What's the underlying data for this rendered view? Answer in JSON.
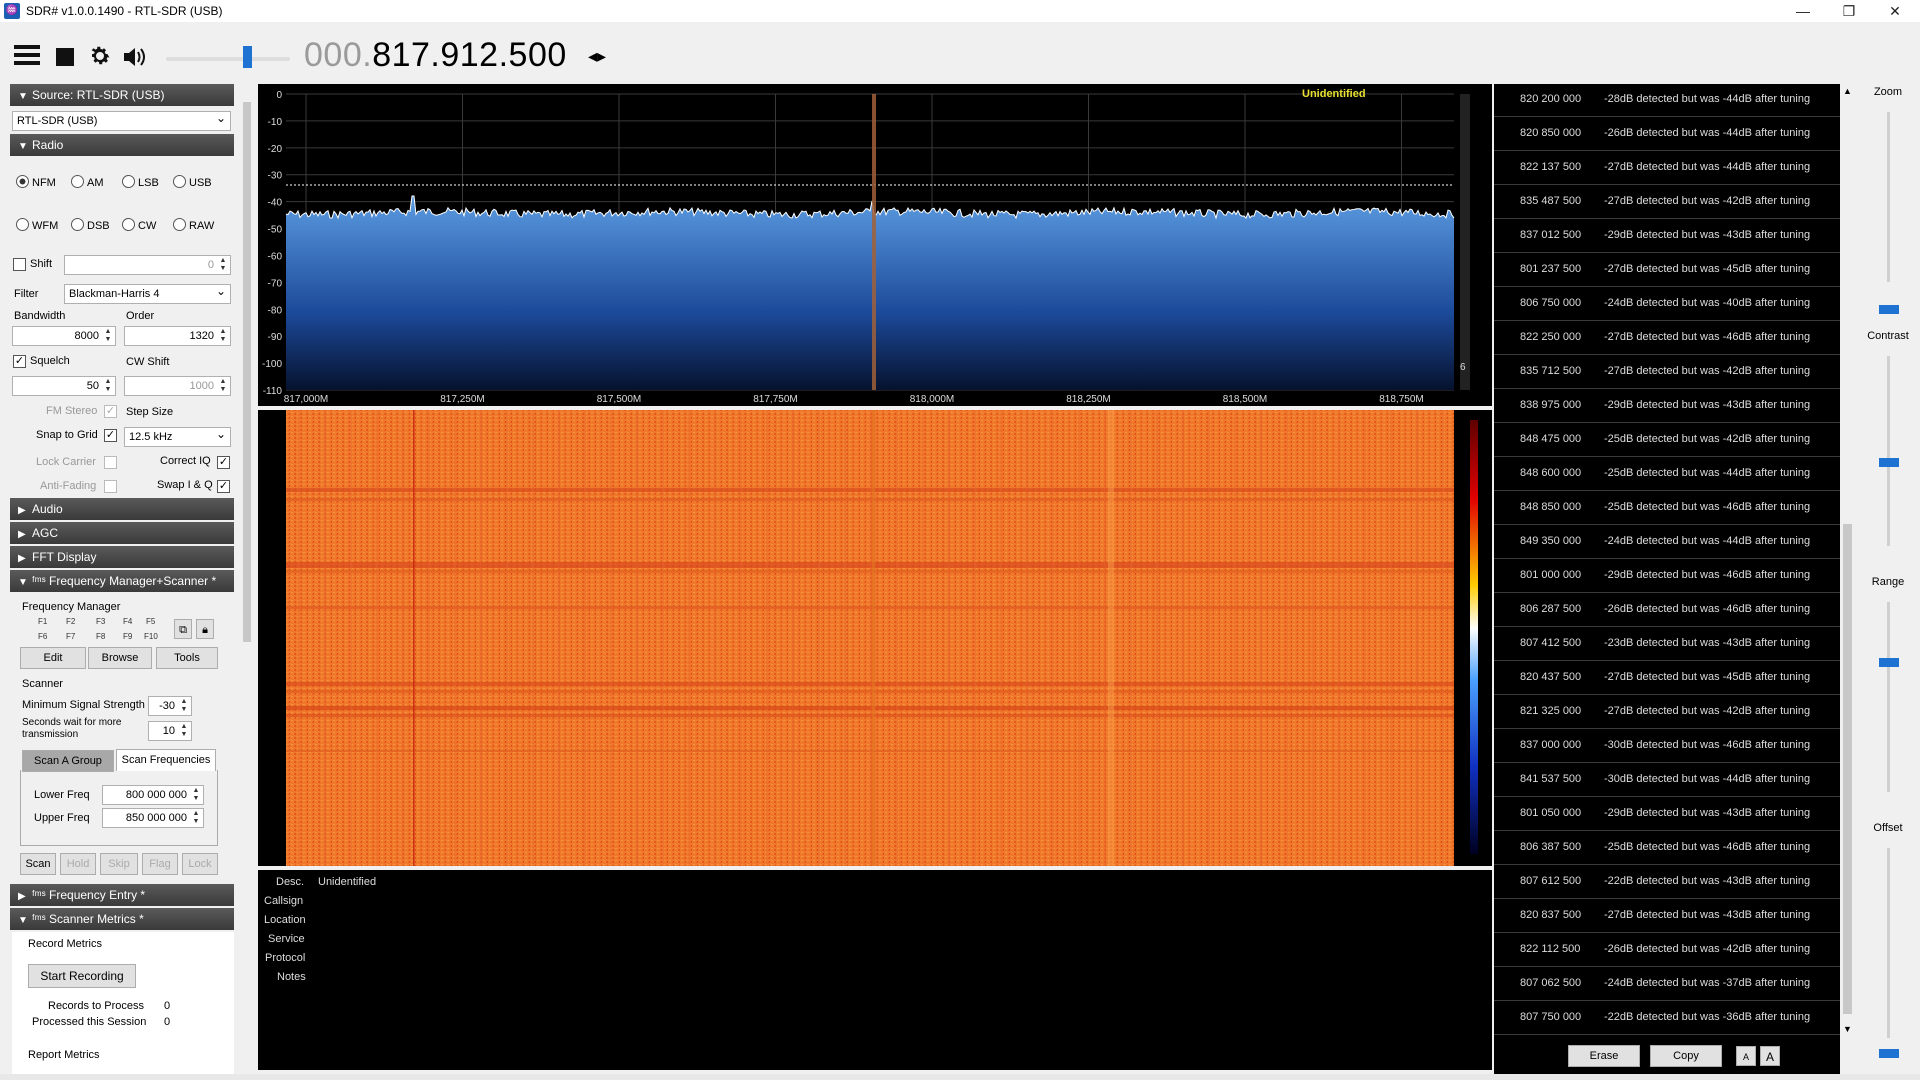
{
  "window": {
    "title": "SDR# v1.0.0.1490 - RTL-SDR (USB)",
    "min": "—",
    "max": "❐",
    "close": "✕"
  },
  "toolbar": {
    "menu_icon": "hamburger-icon",
    "freq_dim": "000.",
    "freq_main": "817.912.500",
    "tune_arrows": "◂▸",
    "volume_percent": 65
  },
  "source": {
    "header": "Source: RTL-SDR (USB)",
    "device": "RTL-SDR (USB)"
  },
  "radio": {
    "header": "Radio",
    "modes": [
      "NFM",
      "AM",
      "LSB",
      "USB",
      "WFM",
      "DSB",
      "CW",
      "RAW"
    ],
    "selected_mode": "NFM",
    "shift_label": "Shift",
    "shift_value": "0",
    "filter_label": "Filter",
    "filter_value": "Blackman-Harris 4",
    "bandwidth_label": "Bandwidth",
    "bandwidth_value": "8000",
    "order_label": "Order",
    "order_value": "1320",
    "squelch_label": "Squelch",
    "squelch_value": "50",
    "cw_shift_label": "CW Shift",
    "cw_shift_value": "1000",
    "fm_stereo_label": "FM Stereo",
    "step_size_label": "Step Size",
    "snap_label": "Snap to Grid",
    "step_value": "12.5 kHz",
    "lock_carrier_label": "Lock Carrier",
    "correct_iq_label": "Correct IQ",
    "anti_fading_label": "Anti-Fading",
    "swap_iq_label": "Swap I & Q"
  },
  "sections": {
    "audio": "Audio",
    "agc": "AGC",
    "fft": "FFT Display",
    "fms": "ᶠᵐˢ Frequency Manager+Scanner *",
    "freq_entry": "ᶠᵐˢ Frequency Entry *",
    "metrics": "ᶠᵐˢ Scanner Metrics *"
  },
  "freqmgr": {
    "title": "Frequency Manager",
    "fkeys_row1": [
      "F1",
      "F2",
      "F3",
      "F4",
      "F5"
    ],
    "fkeys_row2": [
      "F6",
      "F7",
      "F8",
      "F9",
      "F10"
    ],
    "edit": "Edit",
    "browse": "Browse",
    "tools": "Tools"
  },
  "scanner": {
    "title": "Scanner",
    "min_signal_label": "Minimum Signal Strength",
    "min_signal_value": "-30",
    "wait_label_1": "Seconds wait for more",
    "wait_label_2": "transmission",
    "wait_value": "10",
    "tab_group": "Scan A Group",
    "tab_freqs": "Scan Frequencies",
    "lower_label": "Lower Freq",
    "lower_value": "800 000 000",
    "upper_label": "Upper Freq",
    "upper_value": "850 000 000",
    "buttons": [
      "Scan",
      "Hold",
      "Skip",
      "Flag",
      "Lock"
    ]
  },
  "metrics": {
    "record_title": "Record Metrics",
    "start_recording": "Start Recording",
    "records_label": "Records to Process",
    "records_value": "0",
    "processed_label": "Processed this Session",
    "processed_value": "0",
    "report_title": "Report Metrics"
  },
  "spectrum": {
    "label": "Unidentified",
    "y_ticks": [
      "0",
      "-10",
      "-20",
      "-30",
      "-40",
      "-50",
      "-60",
      "-70",
      "-80",
      "-90",
      "-100",
      "-110"
    ],
    "x_ticks": [
      "817,000M",
      "817,250M",
      "817,500M",
      "817,750M",
      "818,000M",
      "818,250M",
      "818,500M",
      "818,750M"
    ],
    "side_number": "6"
  },
  "info": {
    "desc_label": "Desc.",
    "desc_value": "Unidentified",
    "labels": [
      "Callsign",
      "Location",
      "Service",
      "Protocol",
      "Notes"
    ]
  },
  "scan_rows": [
    {
      "freq": "820 200 000",
      "msg": "-28dB detected but was -44dB after tuning"
    },
    {
      "freq": "820 850 000",
      "msg": "-26dB detected but was -44dB after tuning"
    },
    {
      "freq": "822 137 500",
      "msg": "-27dB detected but was -44dB after tuning"
    },
    {
      "freq": "835 487 500",
      "msg": "-27dB detected but was -42dB after tuning"
    },
    {
      "freq": "837 012 500",
      "msg": "-29dB detected but was -43dB after tuning"
    },
    {
      "freq": "801 237 500",
      "msg": "-27dB detected but was -45dB after tuning"
    },
    {
      "freq": "806 750 000",
      "msg": "-24dB detected but was -40dB after tuning"
    },
    {
      "freq": "822 250 000",
      "msg": "-27dB detected but was -46dB after tuning"
    },
    {
      "freq": "835 712 500",
      "msg": "-27dB detected but was -42dB after tuning"
    },
    {
      "freq": "838 975 000",
      "msg": "-29dB detected but was -43dB after tuning"
    },
    {
      "freq": "848 475 000",
      "msg": "-25dB detected but was -42dB after tuning"
    },
    {
      "freq": "848 600 000",
      "msg": "-25dB detected but was -44dB after tuning"
    },
    {
      "freq": "848 850 000",
      "msg": "-25dB detected but was -46dB after tuning"
    },
    {
      "freq": "849 350 000",
      "msg": "-24dB detected but was -44dB after tuning"
    },
    {
      "freq": "801 000 000",
      "msg": "-29dB detected but was -46dB after tuning"
    },
    {
      "freq": "806 287 500",
      "msg": "-26dB detected but was -46dB after tuning"
    },
    {
      "freq": "807 412 500",
      "msg": "-23dB detected but was -43dB after tuning"
    },
    {
      "freq": "820 437 500",
      "msg": "-27dB detected but was -45dB after tuning"
    },
    {
      "freq": "821 325 000",
      "msg": "-27dB detected but was -42dB after tuning"
    },
    {
      "freq": "837 000 000",
      "msg": "-30dB detected but was -46dB after tuning"
    },
    {
      "freq": "841 537 500",
      "msg": "-30dB detected but was -44dB after tuning"
    },
    {
      "freq": "801 050 000",
      "msg": "-29dB detected but was -43dB after tuning"
    },
    {
      "freq": "806 387 500",
      "msg": "-25dB detected but was -46dB after tuning"
    },
    {
      "freq": "807 612 500",
      "msg": "-22dB detected but was -43dB after tuning"
    },
    {
      "freq": "820 837 500",
      "msg": "-27dB detected but was -43dB after tuning"
    },
    {
      "freq": "822 112 500",
      "msg": "-26dB detected but was -42dB after tuning"
    },
    {
      "freq": "807 062 500",
      "msg": "-24dB detected but was -37dB after tuning"
    },
    {
      "freq": "807 750 000",
      "msg": "-22dB detected but was -36dB after tuning"
    }
  ],
  "list_buttons": {
    "erase": "Erase",
    "copy": "Copy",
    "font_small": "A",
    "font_large": "A"
  },
  "right": {
    "zoom": "Zoom",
    "contrast": "Contrast",
    "range": "Range",
    "offset": "Offset"
  },
  "colors": {
    "accent": "#1e73d2",
    "spectrum_top": "#5b9be0",
    "spectrum_bottom": "#06122e",
    "waterfall": "#f07a2a"
  }
}
